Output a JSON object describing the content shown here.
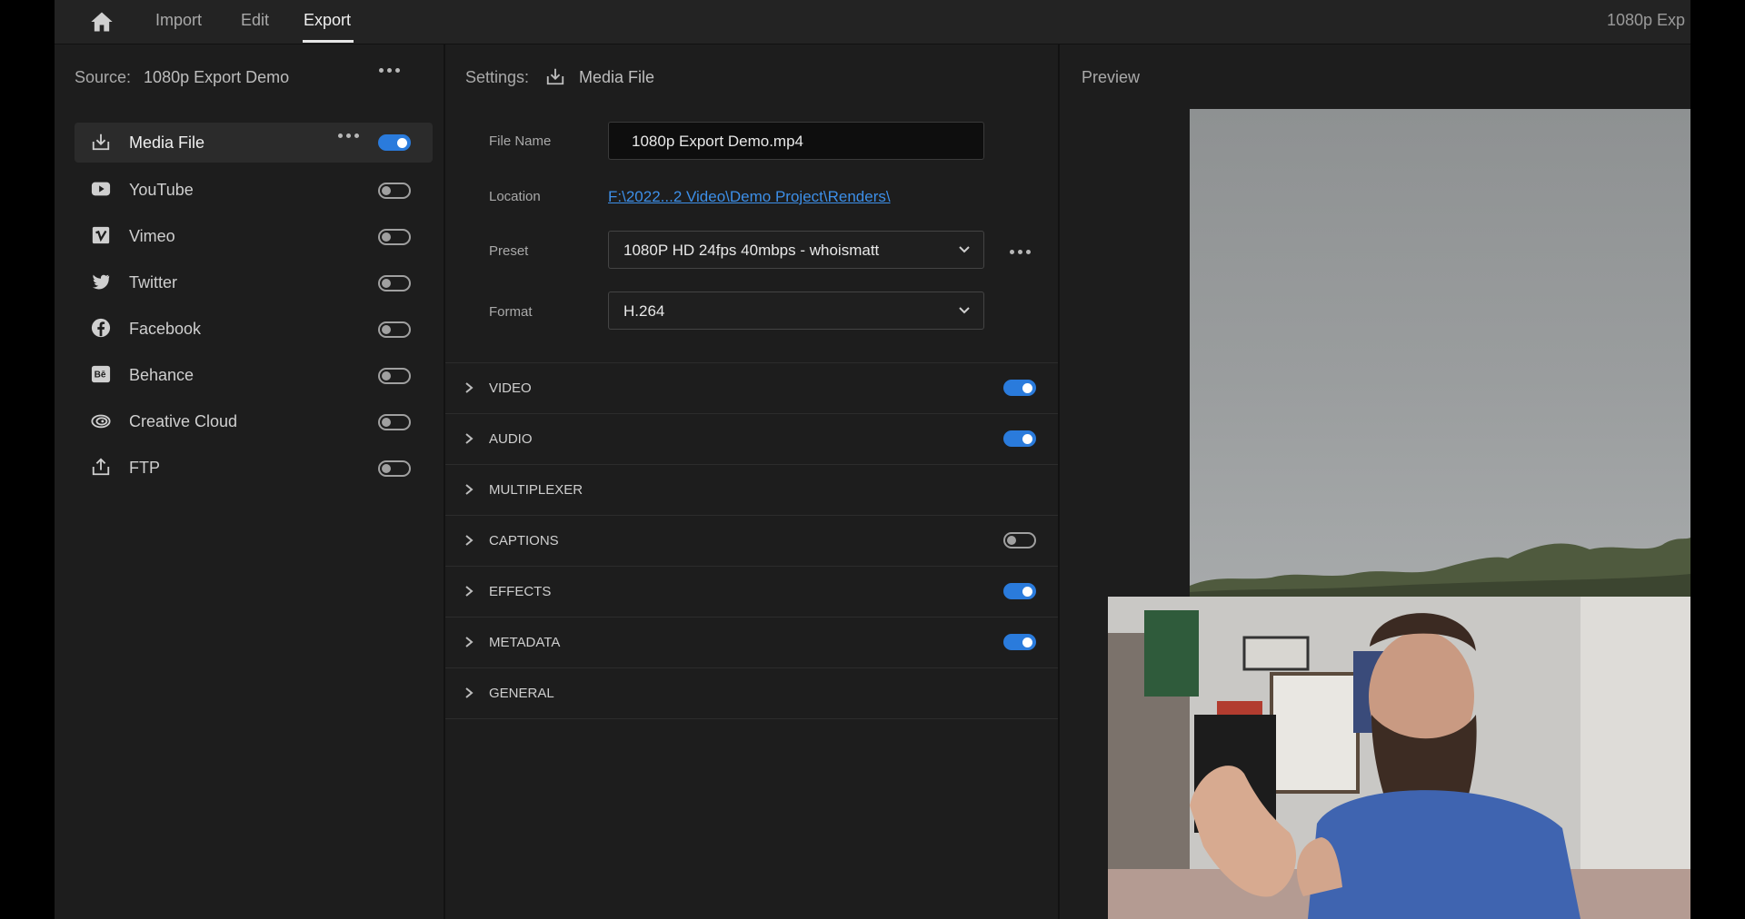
{
  "nav": {
    "tabs": [
      {
        "label": "Import"
      },
      {
        "label": "Edit"
      },
      {
        "label": "Export"
      }
    ],
    "project_title": "1080p Exp"
  },
  "source": {
    "label": "Source:",
    "name": "1080p Export Demo"
  },
  "destinations": [
    {
      "label": "Media File",
      "icon": "export-icon",
      "enabled": true,
      "selected": true
    },
    {
      "label": "YouTube",
      "icon": "youtube-icon",
      "enabled": false
    },
    {
      "label": "Vimeo",
      "icon": "vimeo-icon",
      "enabled": false
    },
    {
      "label": "Twitter",
      "icon": "twitter-icon",
      "enabled": false
    },
    {
      "label": "Facebook",
      "icon": "facebook-icon",
      "enabled": false
    },
    {
      "label": "Behance",
      "icon": "behance-icon",
      "enabled": false
    },
    {
      "label": "Creative Cloud",
      "icon": "creative-cloud-icon",
      "enabled": false
    },
    {
      "label": "FTP",
      "icon": "upload-icon",
      "enabled": false
    }
  ],
  "settings": {
    "label": "Settings:",
    "target": "Media File",
    "file_name_label": "File Name",
    "file_name": "1080p Export Demo.mp4",
    "location_label": "Location",
    "location": "F:\\2022...2 Video\\Demo Project\\Renders\\",
    "preset_label": "Preset",
    "preset": "1080P HD 24fps 40mbps - whoismatt",
    "format_label": "Format",
    "format": "H.264"
  },
  "sections": [
    {
      "name": "VIDEO",
      "toggle": true,
      "enabled": true
    },
    {
      "name": "AUDIO",
      "toggle": true,
      "enabled": true
    },
    {
      "name": "MULTIPLEXER",
      "toggle": false
    },
    {
      "name": "CAPTIONS",
      "toggle": true,
      "enabled": false
    },
    {
      "name": "EFFECTS",
      "toggle": true,
      "enabled": true
    },
    {
      "name": "METADATA",
      "toggle": true,
      "enabled": true
    },
    {
      "name": "GENERAL",
      "toggle": false
    }
  ],
  "preview": {
    "label": "Preview"
  },
  "colors": {
    "accent": "#2a7bdc",
    "link": "#3d8fe8",
    "panel": "#1d1d1d"
  }
}
